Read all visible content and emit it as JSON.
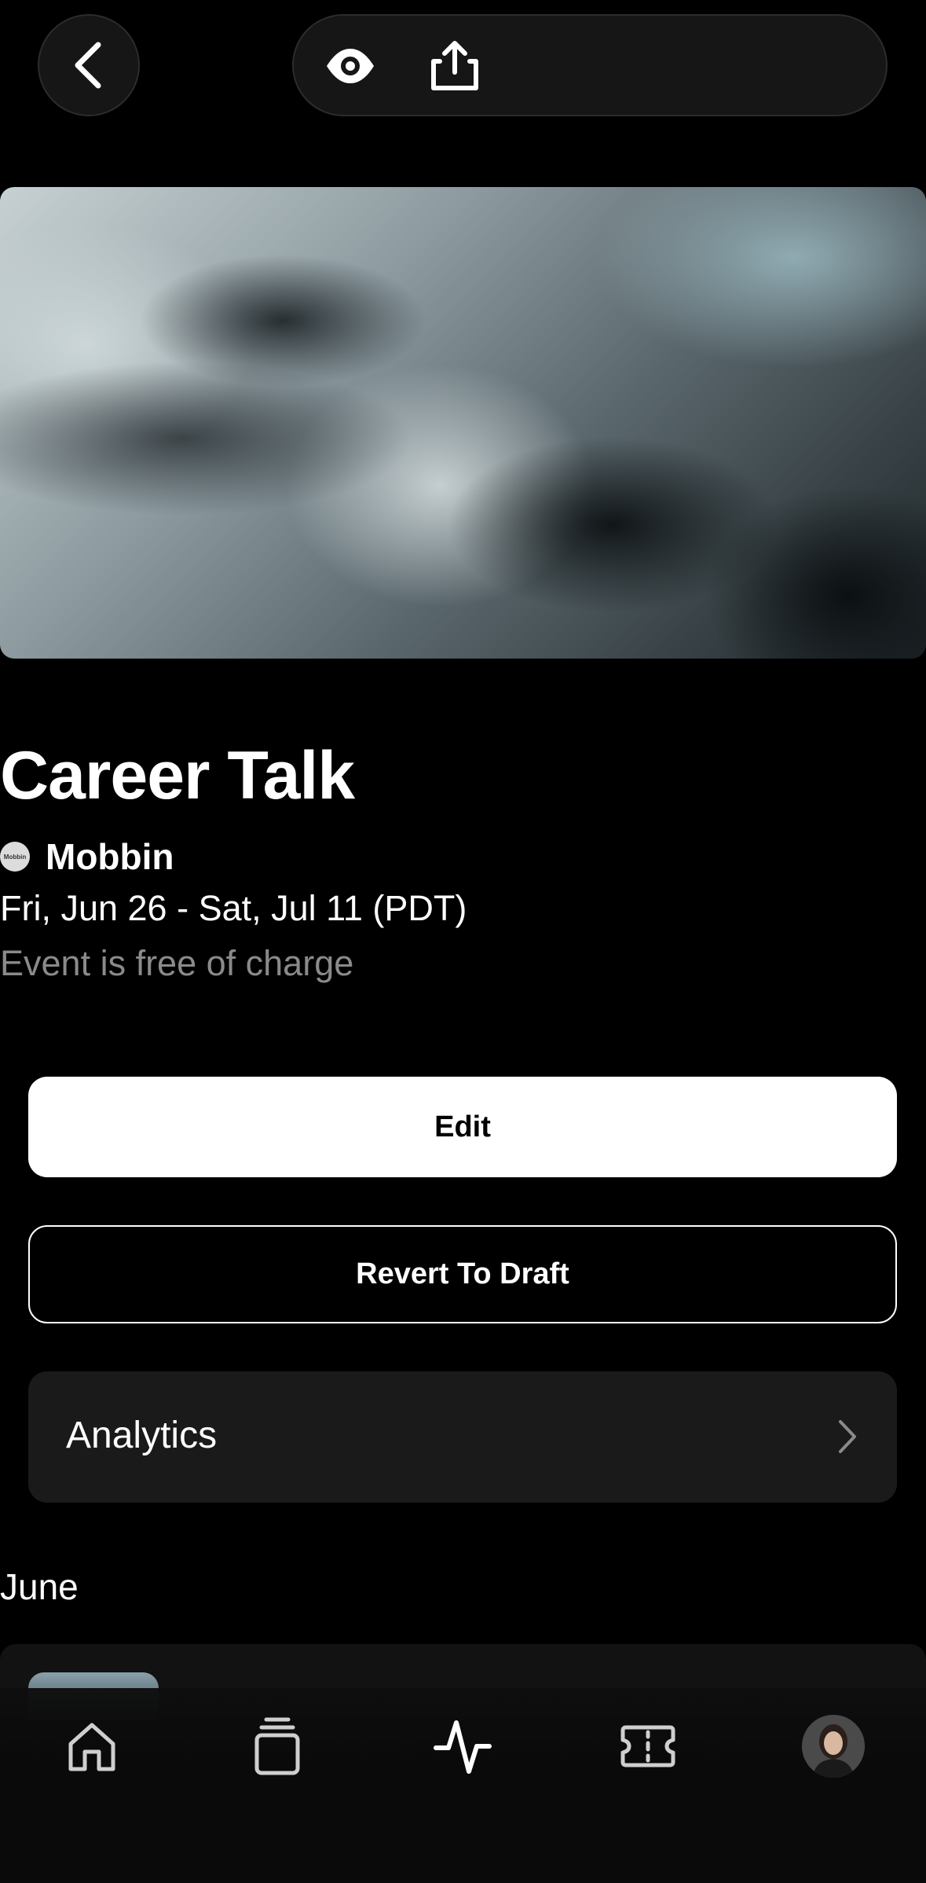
{
  "event": {
    "title": "Career Talk",
    "host": "Mobbin",
    "host_avatar_text": "Mobbin",
    "dates": "Fri, Jun 26 - Sat, Jul 11 (PDT)",
    "price": "Event is free of charge"
  },
  "actions": {
    "edit_label": "Edit",
    "revert_label": "Revert To Draft",
    "analytics_label": "Analytics"
  },
  "sections": {
    "month_label": "June"
  },
  "tabbar": {
    "items": [
      "home-icon",
      "stack-icon",
      "activity-icon",
      "ticket-icon",
      "profile-avatar"
    ],
    "active": "activity-icon"
  }
}
